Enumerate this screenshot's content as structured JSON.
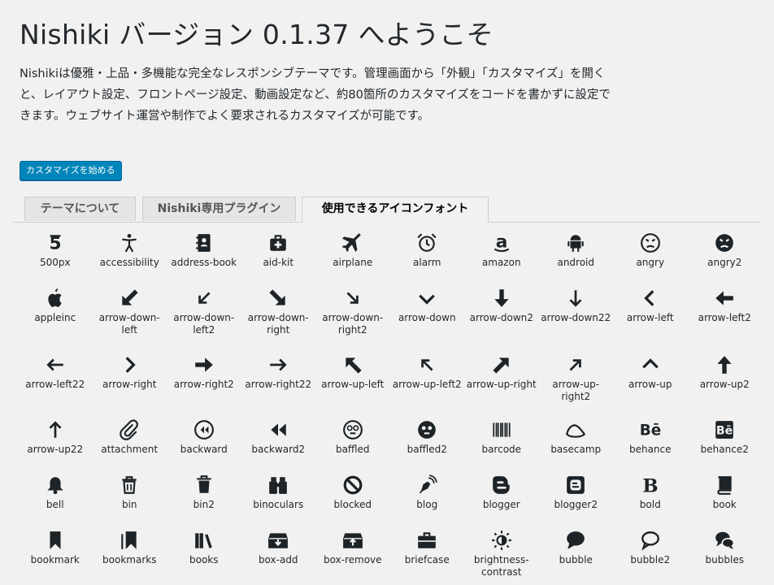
{
  "header": {
    "title": "Nishiki バージョン 0.1.37 へようこそ",
    "intro": "Nishikiは優雅・上品・多機能な完全なレスポンシブテーマです。管理画面から「外観」「カスタマイズ」を開くと、レイアウト設定、フロントページ設定、動画設定など、約80箇所のカスタマイズをコードを書かずに設定できます。ウェブサイト運営や制作でよく要求されるカスタマイズが可能です。",
    "start_button": "カスタマイズを始める"
  },
  "tabs": [
    {
      "label": "テーマについて",
      "active": false
    },
    {
      "label": "Nishiki専用プラグイン",
      "active": false
    },
    {
      "label": "使用できるアイコンフォント",
      "active": true
    }
  ],
  "icons": [
    {
      "name": "500px",
      "icon": "500px-icon"
    },
    {
      "name": "accessibility",
      "icon": "accessibility-icon"
    },
    {
      "name": "address-book",
      "icon": "address-book-icon"
    },
    {
      "name": "aid-kit",
      "icon": "aid-kit-icon"
    },
    {
      "name": "airplane",
      "icon": "airplane-icon"
    },
    {
      "name": "alarm",
      "icon": "alarm-icon"
    },
    {
      "name": "amazon",
      "icon": "amazon-icon"
    },
    {
      "name": "android",
      "icon": "android-icon"
    },
    {
      "name": "angry",
      "icon": "angry-icon"
    },
    {
      "name": "angry2",
      "icon": "angry2-icon"
    },
    {
      "name": "appleinc",
      "icon": "appleinc-icon"
    },
    {
      "name": "arrow-down-left",
      "icon": "arrow-down-left-icon"
    },
    {
      "name": "arrow-down-left2",
      "icon": "arrow-down-left2-icon"
    },
    {
      "name": "arrow-down-right",
      "icon": "arrow-down-right-icon"
    },
    {
      "name": "arrow-down-right2",
      "icon": "arrow-down-right2-icon"
    },
    {
      "name": "arrow-down",
      "icon": "arrow-down-icon"
    },
    {
      "name": "arrow-down2",
      "icon": "arrow-down2-icon"
    },
    {
      "name": "arrow-down22",
      "icon": "arrow-down22-icon"
    },
    {
      "name": "arrow-left",
      "icon": "arrow-left-icon"
    },
    {
      "name": "arrow-left2",
      "icon": "arrow-left2-icon"
    },
    {
      "name": "arrow-left22",
      "icon": "arrow-left22-icon"
    },
    {
      "name": "arrow-right",
      "icon": "arrow-right-icon"
    },
    {
      "name": "arrow-right2",
      "icon": "arrow-right2-icon"
    },
    {
      "name": "arrow-right22",
      "icon": "arrow-right22-icon"
    },
    {
      "name": "arrow-up-left",
      "icon": "arrow-up-left-icon"
    },
    {
      "name": "arrow-up-left2",
      "icon": "arrow-up-left2-icon"
    },
    {
      "name": "arrow-up-right",
      "icon": "arrow-up-right-icon"
    },
    {
      "name": "arrow-up-right2",
      "icon": "arrow-up-right2-icon"
    },
    {
      "name": "arrow-up",
      "icon": "arrow-up-icon"
    },
    {
      "name": "arrow-up2",
      "icon": "arrow-up2-icon"
    },
    {
      "name": "arrow-up22",
      "icon": "arrow-up22-icon"
    },
    {
      "name": "attachment",
      "icon": "attachment-icon"
    },
    {
      "name": "backward",
      "icon": "backward-icon"
    },
    {
      "name": "backward2",
      "icon": "backward2-icon"
    },
    {
      "name": "baffled",
      "icon": "baffled-icon"
    },
    {
      "name": "baffled2",
      "icon": "baffled2-icon"
    },
    {
      "name": "barcode",
      "icon": "barcode-icon"
    },
    {
      "name": "basecamp",
      "icon": "basecamp-icon"
    },
    {
      "name": "behance",
      "icon": "behance-icon"
    },
    {
      "name": "behance2",
      "icon": "behance2-icon"
    },
    {
      "name": "bell",
      "icon": "bell-icon"
    },
    {
      "name": "bin",
      "icon": "bin-icon"
    },
    {
      "name": "bin2",
      "icon": "bin2-icon"
    },
    {
      "name": "binoculars",
      "icon": "binoculars-icon"
    },
    {
      "name": "blocked",
      "icon": "blocked-icon"
    },
    {
      "name": "blog",
      "icon": "blog-icon"
    },
    {
      "name": "blogger",
      "icon": "blogger-icon"
    },
    {
      "name": "blogger2",
      "icon": "blogger2-icon"
    },
    {
      "name": "bold",
      "icon": "bold-icon"
    },
    {
      "name": "book",
      "icon": "book-icon"
    },
    {
      "name": "bookmark",
      "icon": "bookmark-icon"
    },
    {
      "name": "bookmarks",
      "icon": "bookmarks-icon"
    },
    {
      "name": "books",
      "icon": "books-icon"
    },
    {
      "name": "box-add",
      "icon": "box-add-icon"
    },
    {
      "name": "box-remove",
      "icon": "box-remove-icon"
    },
    {
      "name": "briefcase",
      "icon": "briefcase-icon"
    },
    {
      "name": "brightness-contrast",
      "icon": "brightness-contrast-icon"
    },
    {
      "name": "bubble",
      "icon": "bubble-icon"
    },
    {
      "name": "bubble2",
      "icon": "bubble2-icon"
    },
    {
      "name": "bubbles",
      "icon": "bubbles-icon"
    }
  ]
}
